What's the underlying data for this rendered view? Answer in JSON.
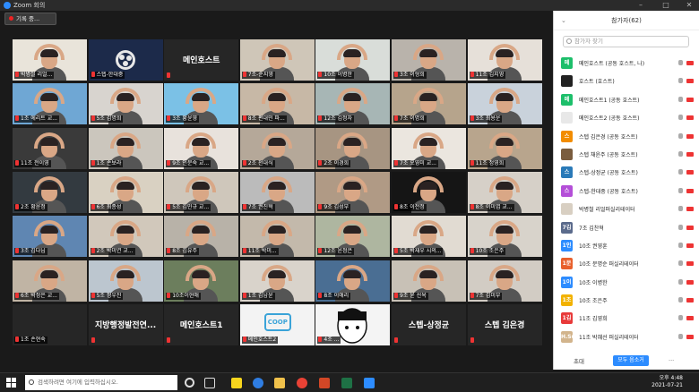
{
  "window": {
    "title": "Zoom 회의"
  },
  "recording": {
    "label": "기록 중..."
  },
  "tiles": [
    {
      "label": "박병철 리얼...",
      "theme": "#e9e4da",
      "hl": true
    },
    {
      "label": "스텝-한대중",
      "theme": "#1c2a4a",
      "obs": true
    },
    {
      "label": "",
      "big": "메인호스트",
      "theme": "#262626"
    },
    {
      "label": "7조-순지영",
      "theme": "#cfc6b8"
    },
    {
      "label": "10조 이병한",
      "theme": "#d9ddd9"
    },
    {
      "label": "3조 이형희",
      "theme": "#b9b3ab"
    },
    {
      "label": "11조 김지영",
      "theme": "#e6e0d9"
    },
    {
      "label": "1조 에리트 교...",
      "theme": "#6fa7d4"
    },
    {
      "label": "5조 김명희",
      "theme": "#d8d4cf"
    },
    {
      "label": "3조 황윤영",
      "theme": "#7bc1e6"
    },
    {
      "label": "8조 편대민 파...",
      "theme": "#c7b8a6"
    },
    {
      "label": "12조 김정자",
      "theme": "#a7b6b5"
    },
    {
      "label": "7조 이명희",
      "theme": "#b6a48c"
    },
    {
      "label": "3조 최용운",
      "theme": "#c9d2db"
    },
    {
      "label": "11조 전이영",
      "theme": "#3a3a3a"
    },
    {
      "label": "1조 손보라",
      "theme": "#cbc6bd"
    },
    {
      "label": "9조 인문숙 교...",
      "theme": "#e8e2dc"
    },
    {
      "label": "2조 천대식",
      "theme": "#b5a899"
    },
    {
      "label": "2조 이경희",
      "theme": "#a79582"
    },
    {
      "label": "7조 오영미 교...",
      "theme": "#ebe6df"
    },
    {
      "label": "11조 정영희",
      "theme": "#b8a58d"
    },
    {
      "label": "2조 황윤정",
      "theme": "#333a40"
    },
    {
      "label": "6조 최종성",
      "theme": "#d9d1c2"
    },
    {
      "label": "5조 김민규 교...",
      "theme": "#cfc7bb"
    },
    {
      "label": "7조 권진혁",
      "theme": "#bbbbbb"
    },
    {
      "label": "9조 김성부",
      "theme": "#b09a85"
    },
    {
      "label": "8조 이전정",
      "theme": "#151515"
    },
    {
      "label": "8조 이미엽 교...",
      "theme": "#d6d0c8"
    },
    {
      "label": "3조 김다님",
      "theme": "#5f86b2"
    },
    {
      "label": "2조 박미연 교...",
      "theme": "#d1c8bb"
    },
    {
      "label": "8조 김유주",
      "theme": "#b8b2a8"
    },
    {
      "label": "11조 박미...",
      "theme": "#c3b9ab"
    },
    {
      "label": "12조 윤정은",
      "theme": "#aeb6a0"
    },
    {
      "label": "5조 박재우 시의...",
      "theme": "#e1dbd2"
    },
    {
      "label": "10조 조은주",
      "theme": "#d8d3cb"
    },
    {
      "label": "6조 박정은 교...",
      "theme": "#c0b4a4"
    },
    {
      "label": "5조 정우진",
      "theme": "#bcc6cf"
    },
    {
      "label": "10조이현애",
      "theme": "#6c7e5d"
    },
    {
      "label": "1조 김남윤",
      "theme": "#d9d3cb"
    },
    {
      "label": "8조 이애리",
      "theme": "#4a6e93"
    },
    {
      "label": "9조 윤 선옥",
      "theme": "#c8c1b6"
    },
    {
      "label": "7조 김미부",
      "theme": "#d2ccc4"
    },
    {
      "label": "1조 손현숙",
      "theme": "#262626",
      "blank": true
    },
    {
      "label": "",
      "big": "지방행정발전연...",
      "theme": "#262626"
    },
    {
      "label": "",
      "big": "메인호스트1",
      "theme": "#262626"
    },
    {
      "label": "메인호스트2",
      "theme": "#f3f3f3",
      "coop": true
    },
    {
      "label": "4조 ...",
      "theme": "#f4f4f4",
      "avatar": true
    },
    {
      "label": "",
      "big": "스텝-상정균",
      "theme": "#262626"
    },
    {
      "label": "",
      "big": "스텝 김은경",
      "theme": "#262626"
    }
  ],
  "coop_logo": "COOP",
  "panel": {
    "title": "참가자(62)",
    "search_placeholder": "참가자 찾기",
    "participants": [
      {
        "name": "메인호스트 (공동 호스트, 나)",
        "badge": "메",
        "color": "#1dbf6b"
      },
      {
        "name": "호스트 (호스트)",
        "badge": "",
        "color": "#222222"
      },
      {
        "name": "메인호스트1 (공동 호스트)",
        "badge": "메",
        "color": "#1dbf6b"
      },
      {
        "name": "메인호스트2 (공동 호스트)",
        "badge": "",
        "color": "#e8e8e8"
      },
      {
        "name": "스텝 김은경 (공동 호스트)",
        "badge": "스",
        "color": "#f28c00"
      },
      {
        "name": "스텝 채윤주 (공동 호스트)",
        "badge": "",
        "color": "#7a5c3e"
      },
      {
        "name": "스텝-상정균 (공동 호스트)",
        "badge": "스",
        "color": "#2a7ab8"
      },
      {
        "name": "스텝-한대중 (공동 호스트)",
        "badge": "스",
        "color": "#b44fd8"
      },
      {
        "name": "박병철 리얼퍼실리테이터",
        "badge": "",
        "color": "#d8cfc2"
      },
      {
        "name": "7조 김찬혁",
        "badge": "7김",
        "color": "#5b6b8c"
      },
      {
        "name": "10조 권영훈",
        "badge": "1인",
        "color": "#2d8cff"
      },
      {
        "name": "10조 문명순 퍼실리테이터",
        "badge": "1문",
        "color": "#e8602c"
      },
      {
        "name": "10조 이병한",
        "badge": "1이",
        "color": "#2d8cff"
      },
      {
        "name": "10조 조은주",
        "badge": "1조",
        "color": "#f2b200"
      },
      {
        "name": "11조 김영희",
        "badge": "1김",
        "color": "#e83a3a"
      },
      {
        "name": "11조 박혜선 퍼실리테이터",
        "badge": "H.Sun",
        "color": "#d2b48c"
      }
    ],
    "invite": "초대",
    "mute_all": "모두 음소거",
    "more": "..."
  },
  "taskbar": {
    "search_placeholder": "검색하려면 여기에 입력하십시오.",
    "time": "오후 4:48",
    "date": "2021-07-21"
  }
}
